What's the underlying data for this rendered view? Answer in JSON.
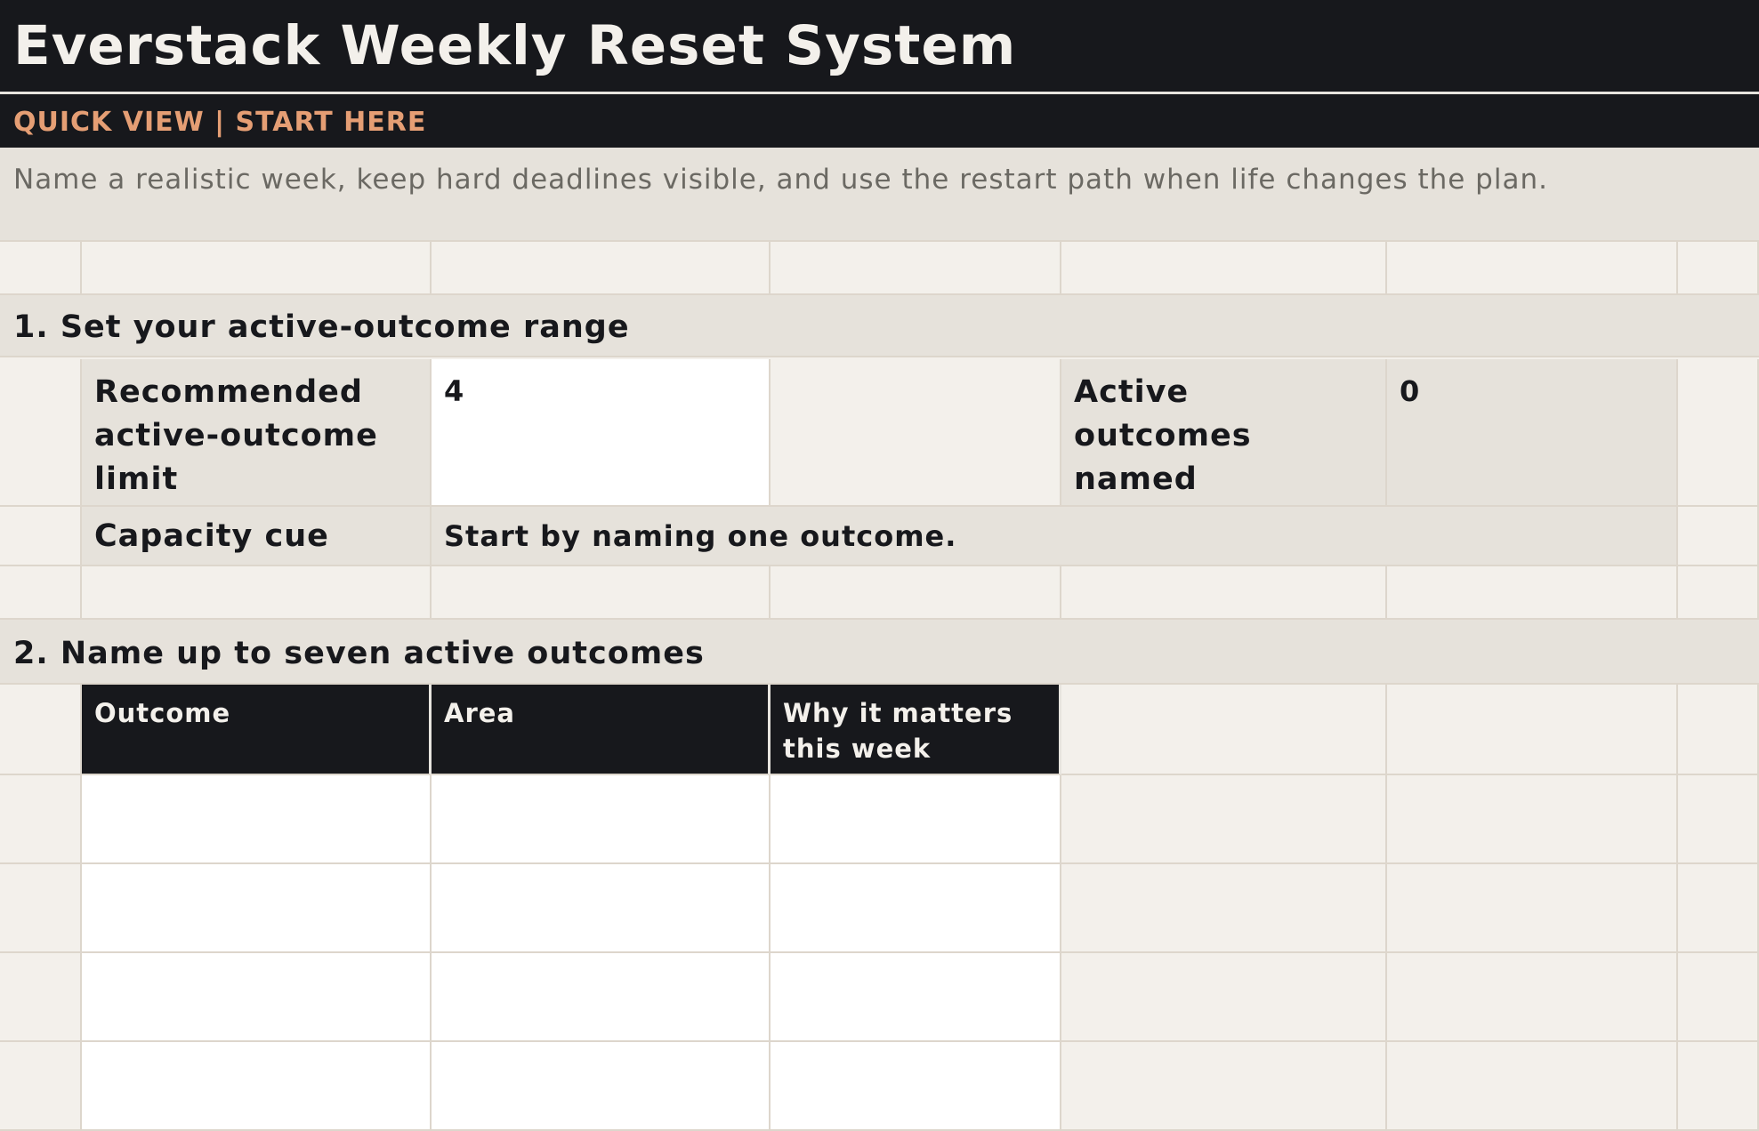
{
  "sheet": {
    "title": "Everstack Weekly Reset System",
    "subtitle": "QUICK VIEW | START HERE",
    "intro": "Name a realistic week, keep hard deadlines visible, and use the restart path when life changes the plan."
  },
  "section1": {
    "heading": "1. Set your active-outcome range",
    "limit_label": "Recommended active-outcome limit",
    "limit_value": "4",
    "named_label": "Active outcomes named",
    "named_value": "0",
    "cue_label": "Capacity cue",
    "cue_value": "Start by naming one outcome."
  },
  "section2": {
    "heading": "2. Name up to seven active outcomes",
    "columns": [
      "Outcome",
      "Area",
      "Why it matters this week"
    ],
    "rows": [
      [
        "",
        "",
        ""
      ],
      [
        "",
        "",
        ""
      ],
      [
        "",
        "",
        ""
      ],
      [
        "",
        "",
        ""
      ]
    ]
  },
  "colors": {
    "header_dark": "#17181c",
    "accent_orange": "#e59e74",
    "band_grey": "#e6e2db",
    "sheet_bg": "#f3f0eb",
    "input_white": "#ffffff"
  }
}
